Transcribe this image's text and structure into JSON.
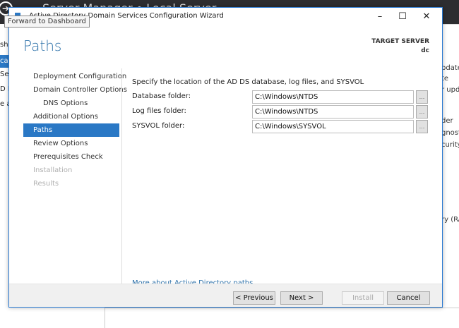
{
  "background": {
    "title": "Server Manager • Local Server",
    "left_items": [
      "shb",
      "cal",
      "Se",
      "D DS",
      "e ar"
    ],
    "right_items": [
      "pdates",
      "te",
      "r upda",
      "der",
      "gnost",
      "curity",
      "ry (RA"
    ]
  },
  "tooltip": "Forward to Dashboard",
  "window": {
    "title": "Active Directory Domain Services Configuration Wizard"
  },
  "heading": "Paths",
  "target_server": {
    "label": "TARGET SERVER",
    "name": "dc"
  },
  "nav": [
    {
      "label": "Deployment Configuration"
    },
    {
      "label": "Domain Controller Options"
    },
    {
      "label": "DNS Options"
    },
    {
      "label": "Additional Options"
    },
    {
      "label": "Paths"
    },
    {
      "label": "Review Options"
    },
    {
      "label": "Prerequisites Check"
    },
    {
      "label": "Installation"
    },
    {
      "label": "Results"
    }
  ],
  "content": {
    "description": "Specify the location of the AD DS database, log files, and SYSVOL",
    "fields": [
      {
        "label": "Database folder:",
        "value": "C:\\Windows\\NTDS",
        "browse": "..."
      },
      {
        "label": "Log files folder:",
        "value": "C:\\Windows\\NTDS",
        "browse": "..."
      },
      {
        "label": "SYSVOL folder:",
        "value": "C:\\Windows\\SYSVOL",
        "browse": "..."
      }
    ],
    "link": "More about Active Directory paths"
  },
  "footer": {
    "previous": "< Previous",
    "next": "Next >",
    "install": "Install",
    "cancel": "Cancel"
  }
}
